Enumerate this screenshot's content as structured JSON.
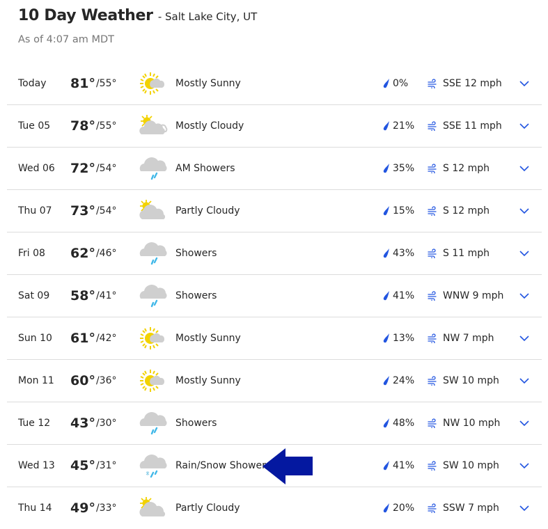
{
  "header": {
    "title": "10 Day Weather",
    "location": "- Salt Lake City, UT",
    "as_of": "As of 4:07 am MDT"
  },
  "colors": {
    "accent": "#2255e0",
    "arrow": "#0418a0",
    "sun": "#f2d200",
    "cloud": "#cfcfcf",
    "rain": "#41b8e8"
  },
  "days": [
    {
      "day": "Today",
      "hi": "81°",
      "lo": "/55°",
      "icon": "mostly-sunny-icon",
      "condition": "Mostly Sunny",
      "precip": "0%",
      "wind": "SSE 12 mph"
    },
    {
      "day": "Tue 05",
      "hi": "78°",
      "lo": "/55°",
      "icon": "mostly-cloudy-icon",
      "condition": "Mostly Cloudy",
      "precip": "21%",
      "wind": "SSE 11 mph"
    },
    {
      "day": "Wed 06",
      "hi": "72°",
      "lo": "/54°",
      "icon": "showers-icon",
      "condition": "AM Showers",
      "precip": "35%",
      "wind": "S 12 mph"
    },
    {
      "day": "Thu 07",
      "hi": "73°",
      "lo": "/54°",
      "icon": "partly-cloudy-icon",
      "condition": "Partly Cloudy",
      "precip": "15%",
      "wind": "S 12 mph"
    },
    {
      "day": "Fri 08",
      "hi": "62°",
      "lo": "/46°",
      "icon": "showers-icon",
      "condition": "Showers",
      "precip": "43%",
      "wind": "S 11 mph"
    },
    {
      "day": "Sat 09",
      "hi": "58°",
      "lo": "/41°",
      "icon": "showers-icon",
      "condition": "Showers",
      "precip": "41%",
      "wind": "WNW 9 mph"
    },
    {
      "day": "Sun 10",
      "hi": "61°",
      "lo": "/42°",
      "icon": "mostly-sunny-icon",
      "condition": "Mostly Sunny",
      "precip": "13%",
      "wind": "NW 7 mph"
    },
    {
      "day": "Mon 11",
      "hi": "60°",
      "lo": "/36°",
      "icon": "mostly-sunny-icon",
      "condition": "Mostly Sunny",
      "precip": "24%",
      "wind": "SW 10 mph"
    },
    {
      "day": "Tue 12",
      "hi": "43°",
      "lo": "/30°",
      "icon": "showers-icon",
      "condition": "Showers",
      "precip": "48%",
      "wind": "NW 10 mph"
    },
    {
      "day": "Wed 13",
      "hi": "45°",
      "lo": "/31°",
      "icon": "rain-snow-icon",
      "condition": "Rain/Snow Showers",
      "precip": "41%",
      "wind": "SW 10 mph"
    },
    {
      "day": "Thu 14",
      "hi": "49°",
      "lo": "/33°",
      "icon": "partly-cloudy-icon",
      "condition": "Partly Cloudy",
      "precip": "20%",
      "wind": "SSW 7 mph"
    }
  ],
  "annotation": {
    "arrow_icon": "left-arrow-icon",
    "points_to_row": 9
  }
}
